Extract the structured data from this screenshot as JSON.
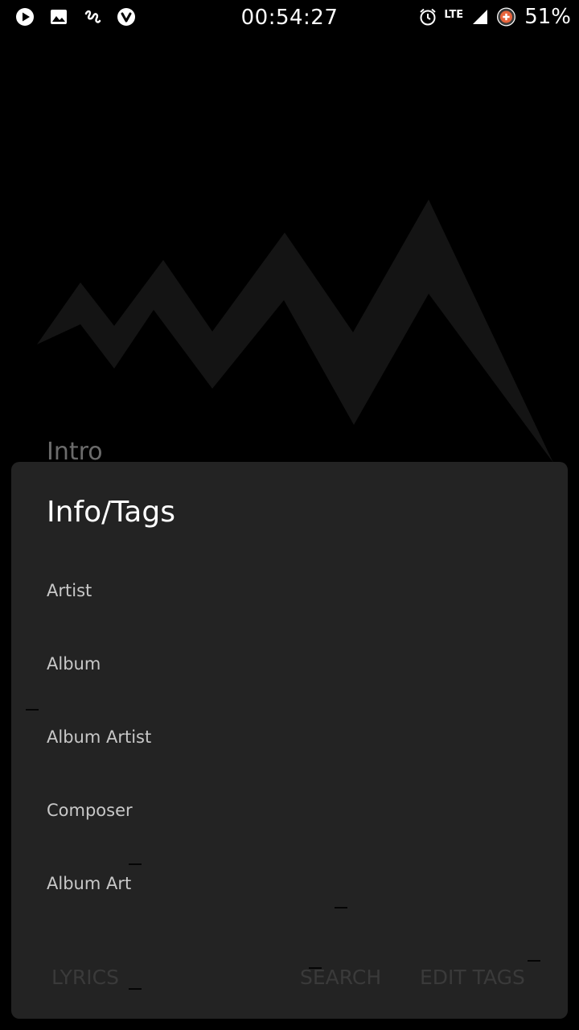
{
  "status_bar": {
    "time": "00:54:27",
    "network": "LTE",
    "battery": "51%",
    "left_icons": [
      "play-icon",
      "image-icon",
      "squiggle-icon",
      "vivaldi-icon"
    ],
    "right_icons": [
      "alarm-icon",
      "signal-icon",
      "battery-saver-icon"
    ]
  },
  "now_playing": {
    "title": "Intro"
  },
  "dialog": {
    "title": "Info/Tags",
    "rows": [
      {
        "label": "Artist"
      },
      {
        "label": "Album"
      },
      {
        "label": "Album Artist"
      },
      {
        "label": "Composer"
      },
      {
        "label": "Album Art"
      }
    ],
    "actions": {
      "lyrics": "Lyrics",
      "search": "Search",
      "edit_tags": "Edit Tags"
    }
  },
  "colors": {
    "background": "#000000",
    "dialog_bg": "#232323",
    "artwork": "#141414",
    "row_text": "#c8c8c8",
    "action_text": "#3a3a3a"
  }
}
